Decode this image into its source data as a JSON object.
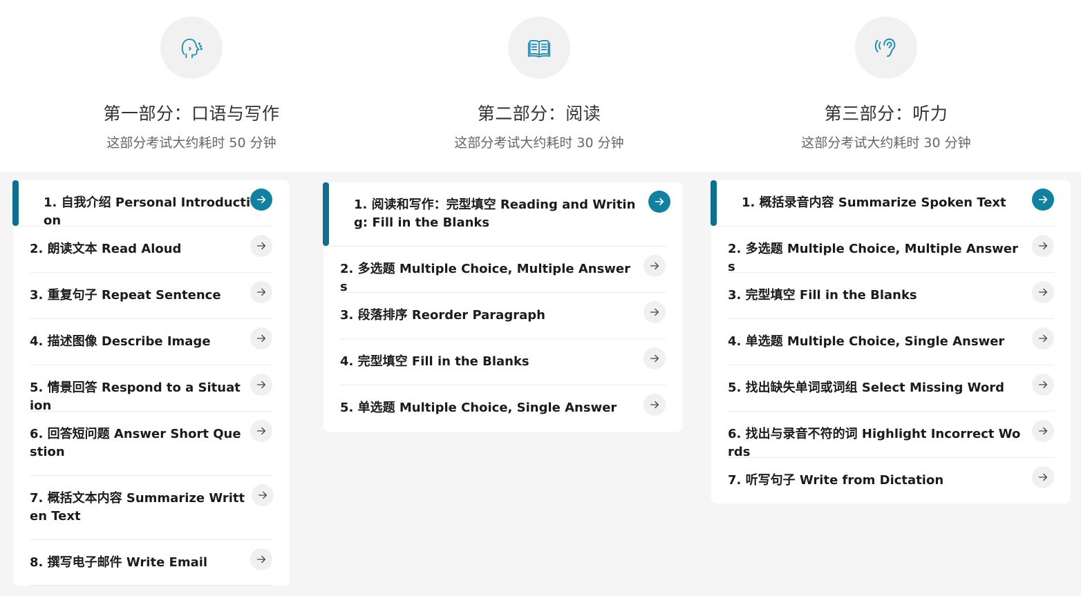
{
  "colors": {
    "accent": "#11819f",
    "active_bar": "#0f6f8f",
    "icon": "#2a8fb0"
  },
  "sections": [
    {
      "icon": "speaking-head-icon",
      "title": "第一部分：口语与写作",
      "subtitle": "这部分考试大约耗时 50 分钟",
      "items": [
        {
          "label": "1. 自我介绍 Personal Introduction",
          "active": true
        },
        {
          "label": "2. 朗读文本 Read Aloud"
        },
        {
          "label": "3. 重复句子 Repeat Sentence"
        },
        {
          "label": "4. 描述图像 Describe Image"
        },
        {
          "label": "5. 情景回答 Respond to a Situation"
        },
        {
          "label": "6. 回答短问题 Answer Short Question"
        },
        {
          "label": "7. 概括文本内容 Summarize Written Text"
        },
        {
          "label": "8. 撰写电子邮件 Write Email"
        }
      ]
    },
    {
      "icon": "open-book-icon",
      "title": "第二部分：阅读",
      "subtitle": "这部分考试大约耗时 30 分钟",
      "items": [
        {
          "label": "1. 阅读和写作：完型填空 Reading and Writing: Fill in the Blanks",
          "active": true
        },
        {
          "label": "2. 多选题 Multiple Choice, Multiple Answers"
        },
        {
          "label": "3. 段落排序 Reorder Paragraph"
        },
        {
          "label": "4. 完型填空 Fill in the Blanks"
        },
        {
          "label": "5. 单选题 Multiple Choice, Single Answer"
        }
      ]
    },
    {
      "icon": "ear-listening-icon",
      "title": "第三部分：听力",
      "subtitle": "这部分考试大约耗时 30 分钟",
      "items": [
        {
          "label": "1. 概括录音内容 Summarize Spoken Text",
          "active": true
        },
        {
          "label": "2. 多选题 Multiple Choice, Multiple Answers"
        },
        {
          "label": "3. 完型填空 Fill in the Blanks"
        },
        {
          "label": "4. 单选题 Multiple Choice, Single Answer"
        },
        {
          "label": "5. 找出缺失单词或词组 Select Missing Word"
        },
        {
          "label": "6. 找出与录音不符的词 Highlight Incorrect Words"
        },
        {
          "label": "7. 听写句子 Write from Dictation"
        }
      ]
    }
  ]
}
